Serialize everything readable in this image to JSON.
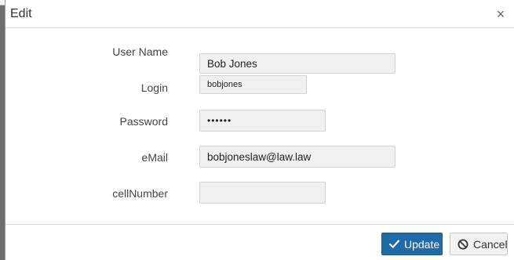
{
  "dialog": {
    "title": "Edit",
    "close_glyph": "×"
  },
  "form": {
    "user_name_label": "User Name",
    "user_name_value": "Bob Jones",
    "login_label": "Login",
    "login_value": "bobjones",
    "password_label": "Password",
    "password_value": "••••••",
    "email_label": "eMail",
    "email_value": "bobjoneslaw@law.law",
    "cell_label": "cellNumber",
    "cell_value": ""
  },
  "footer": {
    "update_label": "Update",
    "cancel_label": "Cancel",
    "update_icon": "check-icon",
    "cancel_icon": "ban-icon"
  },
  "colors": {
    "primary": "#1f6aa8",
    "field_bg": "#f0f0f0"
  }
}
